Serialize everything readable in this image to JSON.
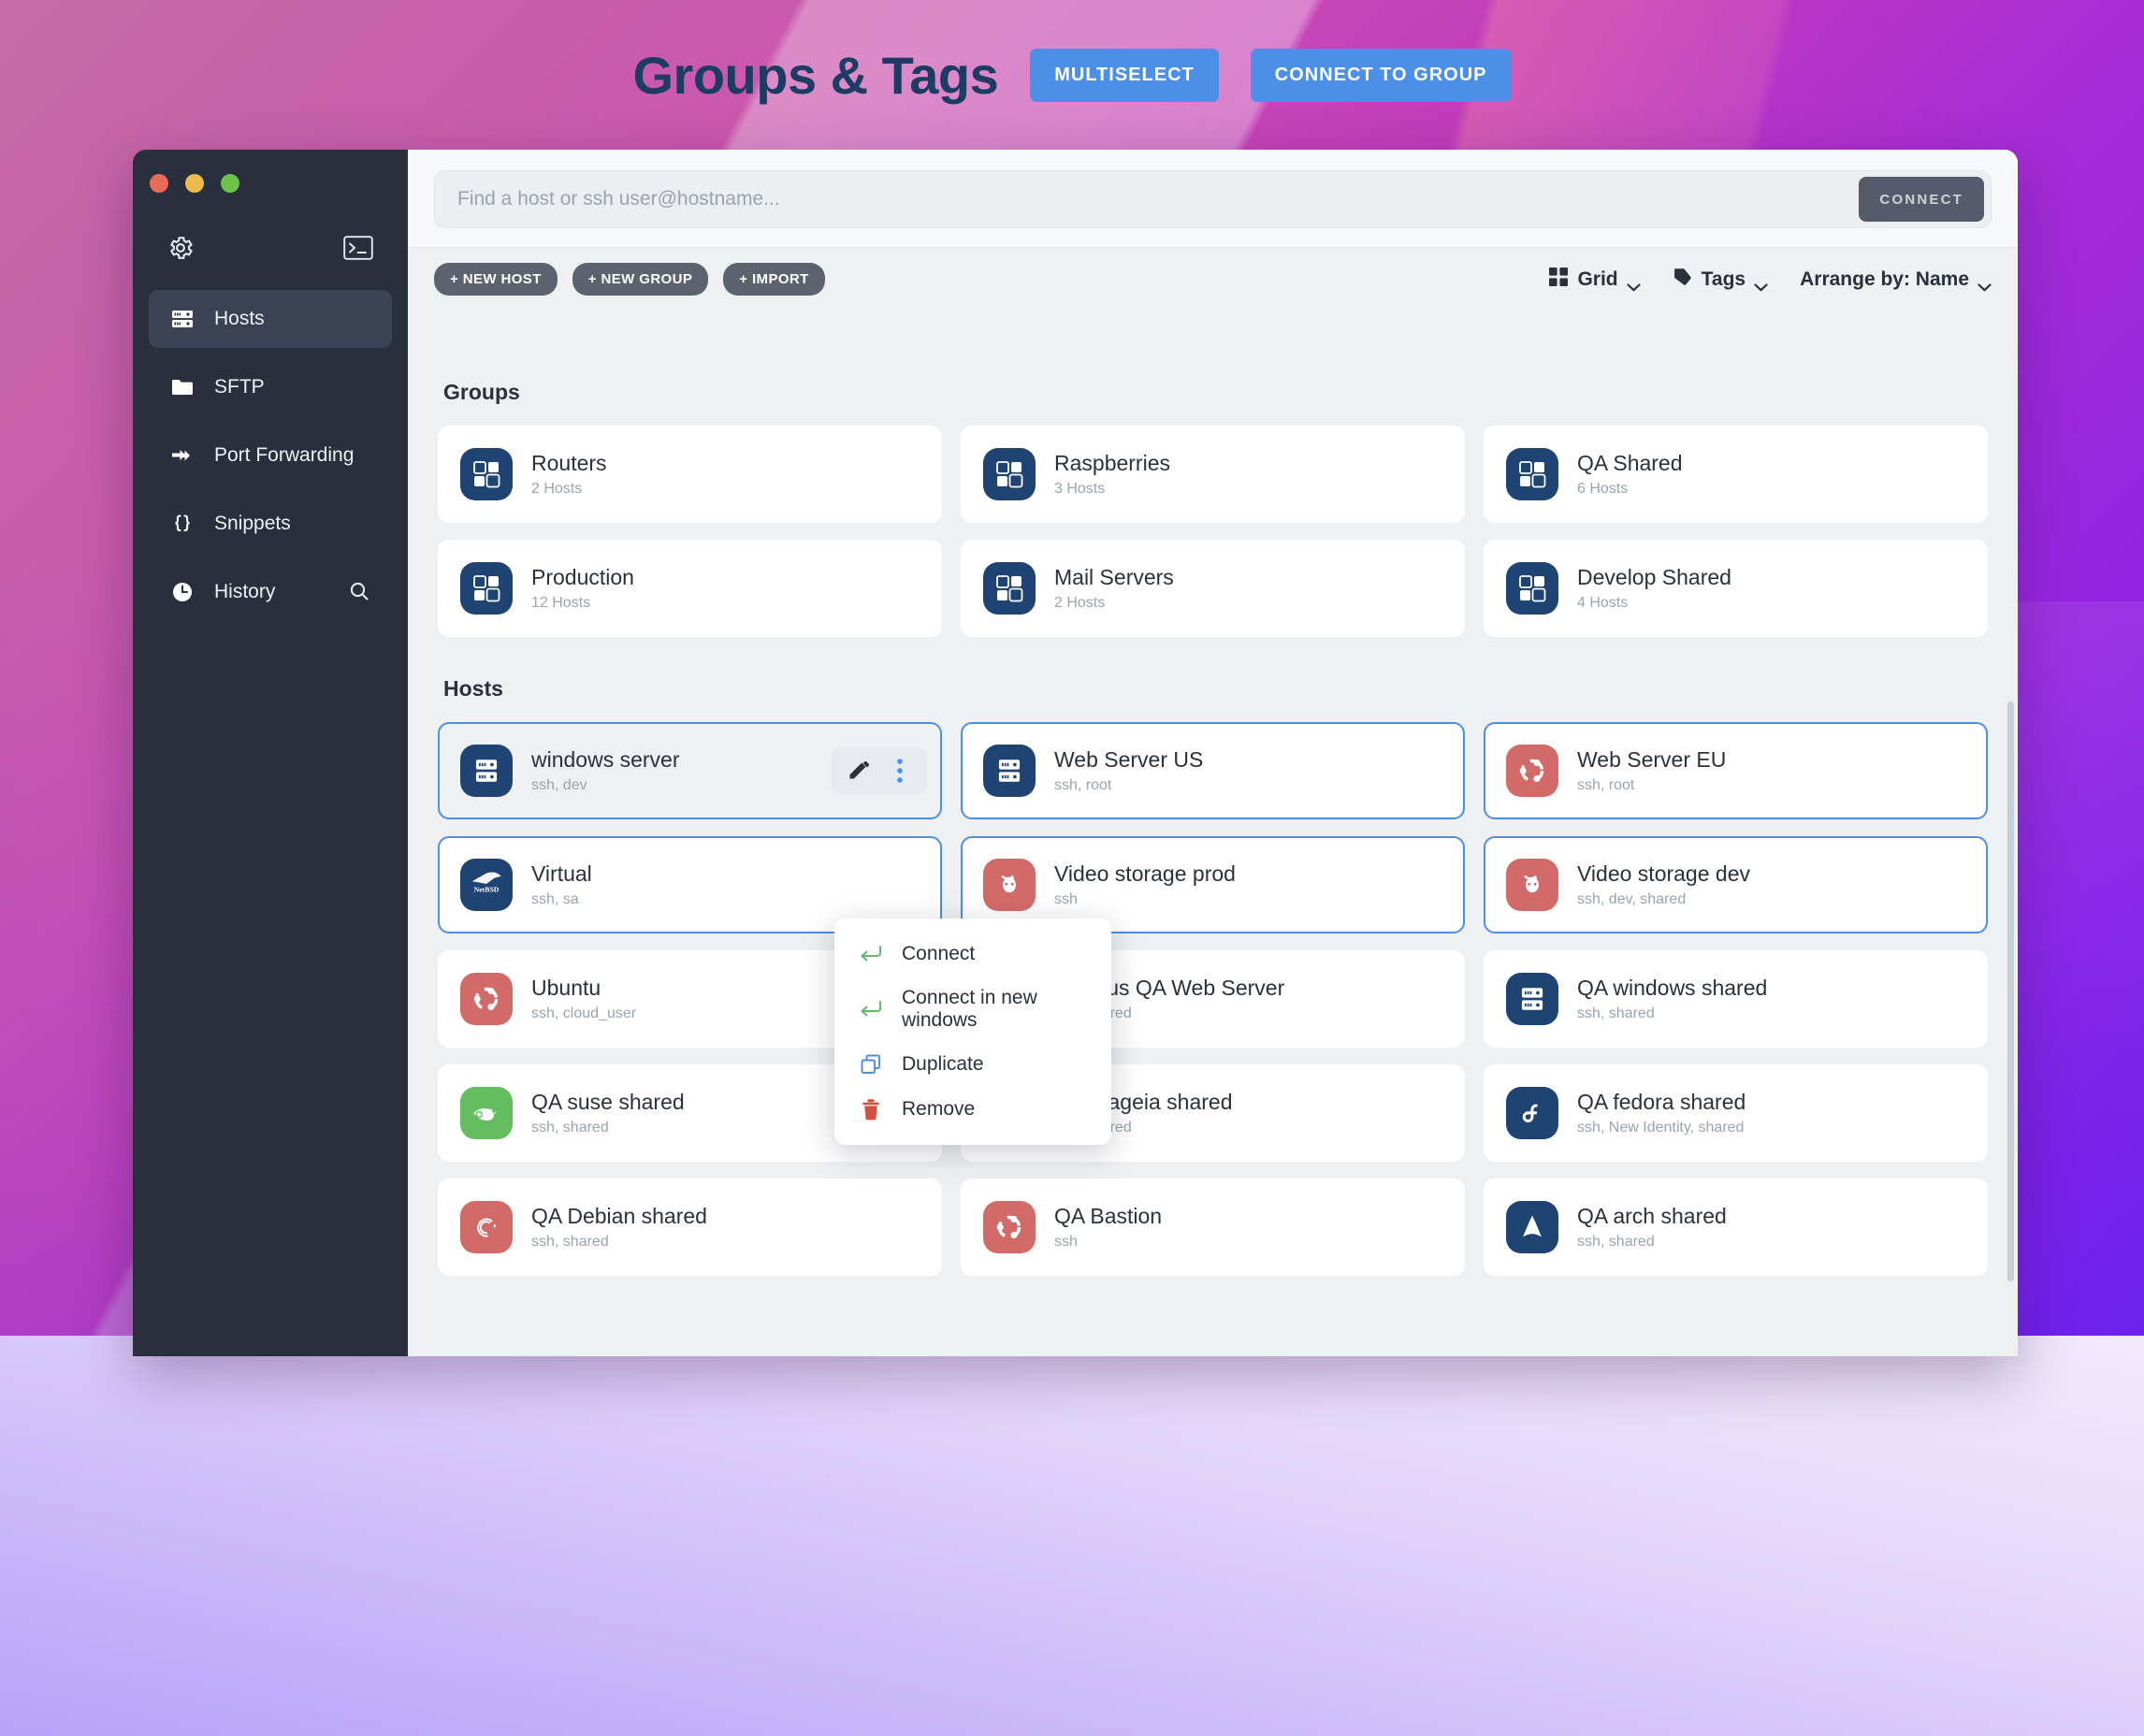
{
  "header": {
    "title": "Groups & Tags",
    "multiselect_label": "MULTISELECT",
    "connect_group_label": "CONNECT TO GROUP",
    "accent_color": "#4b8fe8",
    "title_color": "#1d3c64"
  },
  "sidebar": {
    "gear_icon": "gear-icon",
    "terminal_icon": "terminal-icon",
    "search_icon": "search-icon",
    "items": [
      {
        "label": "Hosts",
        "icon": "server-icon",
        "active": true
      },
      {
        "label": "SFTP",
        "icon": "folder-icon",
        "active": false
      },
      {
        "label": "Port Forwarding",
        "icon": "port-forward-icon",
        "active": false
      },
      {
        "label": "Snippets",
        "icon": "curly-braces-icon",
        "active": false
      },
      {
        "label": "History",
        "icon": "clock-icon",
        "active": false
      }
    ],
    "traffic_lights": [
      "close",
      "minimize",
      "zoom"
    ]
  },
  "search": {
    "placeholder": "Find a host or ssh user@hostname...",
    "value": "",
    "connect_label": "CONNECT"
  },
  "toolbar": {
    "new_host_label": "+ NEW HOST",
    "new_group_label": "+ NEW GROUP",
    "import_label": "+ IMPORT",
    "grid_label": "Grid",
    "tags_label": "Tags",
    "arrange_label": "Arrange by: Name"
  },
  "groups_section": {
    "title": "Groups",
    "items": [
      {
        "name": "Routers",
        "sub": "2 Hosts"
      },
      {
        "name": "Raspberries",
        "sub": "3 Hosts"
      },
      {
        "name": "QA Shared",
        "sub": "6 Hosts"
      },
      {
        "name": "Production",
        "sub": "12 Hosts"
      },
      {
        "name": "Mail Servers",
        "sub": "2 Hosts"
      },
      {
        "name": "Develop Shared",
        "sub": "4 Hosts"
      }
    ]
  },
  "hosts_section": {
    "title": "Hosts",
    "items": [
      {
        "name": "windows server",
        "sub": "ssh, dev",
        "icon": "server-icon",
        "color": "navy",
        "state": "selected"
      },
      {
        "name": "Web Server US",
        "sub": "ssh, root",
        "icon": "server-icon",
        "color": "navy",
        "state": "outlined"
      },
      {
        "name": "Web Server EU",
        "sub": "ssh, root",
        "icon": "ubuntu-icon",
        "color": "red",
        "state": "outlined"
      },
      {
        "name": "Virtual",
        "sub": "ssh, sa",
        "icon": "netbsd-icon",
        "color": "navy",
        "state": "outlined"
      },
      {
        "name": "Video storage prod",
        "sub": "ssh",
        "icon": "freebsd-icon",
        "color": "red",
        "state": "outlined"
      },
      {
        "name": "Video storage dev",
        "sub": "ssh, dev, shared",
        "icon": "freebsd-icon",
        "color": "red",
        "state": "outlined"
      },
      {
        "name": "Ubuntu",
        "sub": "ssh, cloud_user",
        "icon": "ubuntu-icon",
        "color": "red",
        "state": "normal"
      },
      {
        "name": "Termius QA Web Server",
        "sub": "ssh, shared",
        "icon": "mageia-icon",
        "color": "navy",
        "state": "normal"
      },
      {
        "name": "QA windows shared",
        "sub": "ssh, shared",
        "icon": "server-icon",
        "color": "navy",
        "state": "normal"
      },
      {
        "name": "QA suse shared",
        "sub": "ssh, shared",
        "icon": "suse-icon",
        "color": "green",
        "state": "normal"
      },
      {
        "name": "QA mageia shared",
        "sub": "ssh, shared",
        "icon": "mageia-icon",
        "color": "navy",
        "state": "normal"
      },
      {
        "name": "QA fedora shared",
        "sub": "ssh, New Identity, shared",
        "icon": "fedora-icon",
        "color": "navy",
        "state": "normal"
      },
      {
        "name": "QA Debian shared",
        "sub": "ssh, shared",
        "icon": "debian-icon",
        "color": "red",
        "state": "normal"
      },
      {
        "name": "QA Bastion",
        "sub": "ssh",
        "icon": "ubuntu-icon",
        "color": "red",
        "state": "normal"
      },
      {
        "name": "QA arch shared",
        "sub": "ssh, shared",
        "icon": "arch-icon",
        "color": "navy",
        "state": "normal"
      }
    ],
    "card_actions": {
      "edit_icon": "pencil-icon",
      "more_icon": "three-dots-icon"
    }
  },
  "context_menu": {
    "items": [
      {
        "label": "Connect",
        "icon": "enter-arrow-icon",
        "color": "#62bb70"
      },
      {
        "label": "Connect in new windows",
        "icon": "enter-arrow-icon",
        "color": "#62bb70"
      },
      {
        "label": "Duplicate",
        "icon": "duplicate-icon",
        "color": "#4b8fe8"
      },
      {
        "label": "Remove",
        "icon": "trash-icon",
        "color": "#d45045"
      }
    ]
  }
}
